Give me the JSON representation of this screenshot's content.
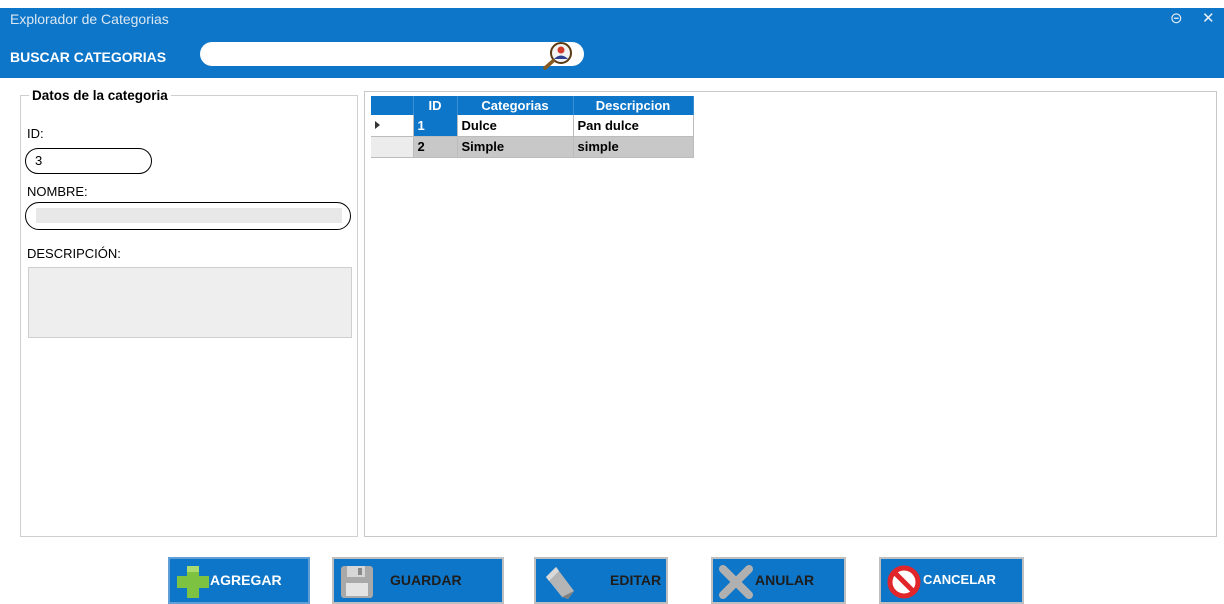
{
  "window": {
    "title": "Explorador de Categorias",
    "minimize_icon": "minimize-circle-icon",
    "close_icon": "close-icon",
    "minimize_glyph": "⊝",
    "close_glyph": "✕"
  },
  "search": {
    "label": "BUSCAR CATEGORIAS",
    "value": "",
    "icon": "search-user-icon"
  },
  "form": {
    "legend": "Datos de la categoria",
    "id_label": "ID:",
    "id_value": "3",
    "nombre_label": "NOMBRE:",
    "nombre_value": "",
    "descripcion_label": "DESCRIPCIÓN:",
    "descripcion_value": ""
  },
  "grid": {
    "columns": [
      "ID",
      "Categorias",
      "Descripcion"
    ],
    "rows": [
      {
        "id": "1",
        "categoria": "Dulce",
        "descripcion": "Pan dulce"
      },
      {
        "id": "2",
        "categoria": "Simple",
        "descripcion": "simple"
      }
    ]
  },
  "buttons": {
    "agregar": "AGREGAR",
    "guardar": "GUARDAR",
    "editar": "EDITAR",
    "anular": "ANULAR",
    "cancelar": "CANCELAR"
  },
  "colors": {
    "accent": "#0e76c8",
    "selected_row_alt": "#c8c8c8"
  }
}
